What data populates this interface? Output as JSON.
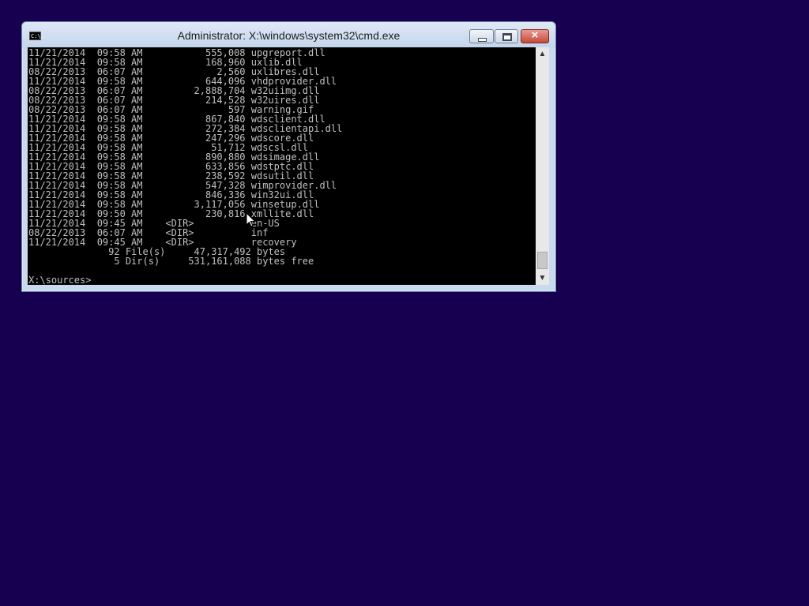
{
  "window": {
    "title": "Administrator: X:\\windows\\system32\\cmd.exe",
    "icon_text": "C:\\.",
    "icon_name": "console-app-icon",
    "controls": {
      "minimize": "minimize-icon",
      "maximize": "maximize-icon",
      "close": "×"
    }
  },
  "console": {
    "text": "11/21/2014  09:58 AM           555,008 upgreport.dll\n11/21/2014  09:58 AM           168,960 uxlib.dll\n08/22/2013  06:07 AM             2,560 uxlibres.dll\n11/21/2014  09:58 AM           644,096 vhdprovider.dll\n08/22/2013  06:07 AM         2,888,704 w32uiimg.dll\n08/22/2013  06:07 AM           214,528 w32uires.dll\n08/22/2013  06:07 AM               597 warning.gif\n11/21/2014  09:58 AM           867,840 wdsclient.dll\n11/21/2014  09:58 AM           272,384 wdsclientapi.dll\n11/21/2014  09:58 AM           247,296 wdscore.dll\n11/21/2014  09:58 AM            51,712 wdscsl.dll\n11/21/2014  09:58 AM           890,880 wdsimage.dll\n11/21/2014  09:58 AM           633,856 wdstptc.dll\n11/21/2014  09:58 AM           238,592 wdsutil.dll\n11/21/2014  09:58 AM           547,328 wimprovider.dll\n11/21/2014  09:58 AM           846,336 win32ui.dll\n11/21/2014  09:58 AM         3,117,056 winsetup.dll\n11/21/2014  09:50 AM           230,816 xmllite.dll\n11/21/2014  09:45 AM    <DIR>          en-US\n08/22/2013  06:07 AM    <DIR>          inf\n11/21/2014  09:45 AM    <DIR>          recovery\n              92 File(s)     47,317,492 bytes\n               5 Dir(s)     531,161,088 bytes free\n\nX:\\sources>"
  },
  "scrollbar": {
    "up_icon": "▲",
    "down_icon": "▼"
  },
  "colors": {
    "desktop": "#180050",
    "console_bg": "#000000",
    "console_fg": "#c0c0c0"
  }
}
